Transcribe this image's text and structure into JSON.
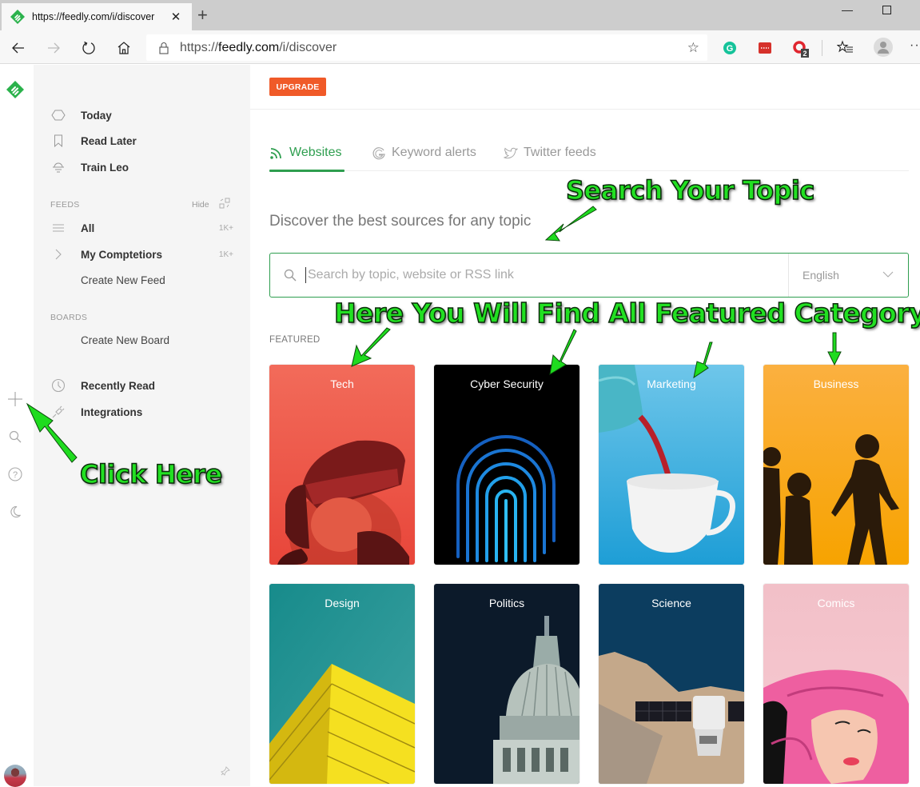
{
  "browser": {
    "tab": {
      "title": "https://feedly.com/i/discover",
      "close_icon": "close-icon"
    },
    "new_tab_icon": "plus-icon",
    "window_controls": [
      "minimize-icon",
      "maximize-icon",
      "close-icon"
    ],
    "address": {
      "prefix": "https://",
      "domain": "feedly.com",
      "path": "/i/discover"
    },
    "extensions": [
      {
        "name": "grammarly",
        "color": "#15c39a",
        "glyph": "G"
      },
      {
        "name": "red-extension",
        "color": "#d6312b",
        "glyph": ""
      },
      {
        "name": "opera-like-extension",
        "color": "#e0262f",
        "badge": "2"
      }
    ]
  },
  "sidebar": {
    "primary": [
      {
        "label": "Today",
        "icon": "today-icon"
      },
      {
        "label": "Read Later",
        "icon": "bookmark-icon"
      },
      {
        "label": "Train Leo",
        "icon": "leo-icon"
      }
    ],
    "feeds": {
      "heading": "FEEDS",
      "hide_label": "Hide",
      "items": [
        {
          "label": "All",
          "count": "1K+",
          "icon": "list-icon"
        },
        {
          "label": "My Comptetiors",
          "count": "1K+",
          "icon": "chevron-right-icon"
        }
      ],
      "create_label": "Create New Feed"
    },
    "boards": {
      "heading": "BOARDS",
      "create_label": "Create New Board"
    },
    "secondary": [
      {
        "label": "Recently Read",
        "icon": "clock-icon"
      },
      {
        "label": "Integrations",
        "icon": "plug-icon"
      }
    ]
  },
  "rail": {
    "buttons": [
      "add-icon",
      "search-icon",
      "help-icon",
      "moon-icon"
    ]
  },
  "main": {
    "upgrade_label": "UPGRADE",
    "tabs": [
      {
        "label": "Websites",
        "icon": "rss-icon",
        "active": true
      },
      {
        "label": "Keyword alerts",
        "icon": "google-icon",
        "active": false
      },
      {
        "label": "Twitter feeds",
        "icon": "twitter-icon",
        "active": false
      }
    ],
    "discover_title": "Discover the best sources for any topic",
    "search": {
      "placeholder": "Search by topic, website or RSS link",
      "value": ""
    },
    "language": "English",
    "featured_label": "FEATURED",
    "categories": [
      {
        "label": "Tech"
      },
      {
        "label": "Cyber Security"
      },
      {
        "label": "Marketing"
      },
      {
        "label": "Business"
      },
      {
        "label": "Design"
      },
      {
        "label": "Politics"
      },
      {
        "label": "Science"
      },
      {
        "label": "Comics"
      }
    ],
    "accent_color": "#2e9e4f",
    "upgrade_color": "#f05a28"
  },
  "annotations": {
    "search_topic": "Search Your Topic",
    "featured": "Here You Will Find All Featured Category",
    "click_here": "Click Here"
  }
}
